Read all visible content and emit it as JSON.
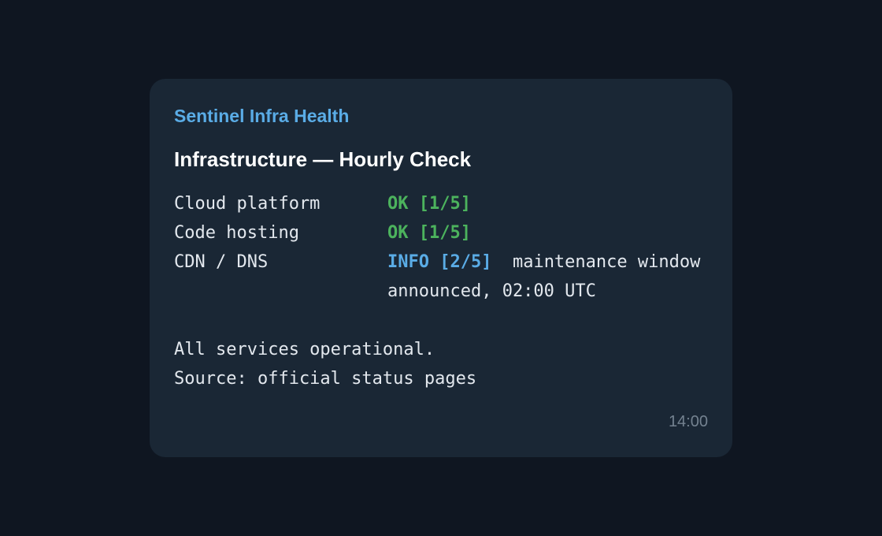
{
  "message": {
    "sender": "Sentinel Infra Health",
    "title": "Infrastructure — Hourly Check",
    "services": [
      {
        "name": "Cloud platform",
        "status": "OK [1/5]",
        "level": "ok",
        "note": ""
      },
      {
        "name": "Code hosting",
        "status": "OK [1/5]",
        "level": "ok",
        "note": ""
      },
      {
        "name": "CDN / DNS",
        "status": "INFO [2/5]",
        "level": "info",
        "note": "maintenance window announced, 02:00 UTC"
      }
    ],
    "summary": "All services operational.",
    "source": "Source: official status pages",
    "time": "14:00"
  },
  "colors": {
    "background": "#0f1621",
    "card": "#1a2735",
    "sender": "#5aace6",
    "ok": "#4cb35d",
    "info": "#5aace6"
  }
}
